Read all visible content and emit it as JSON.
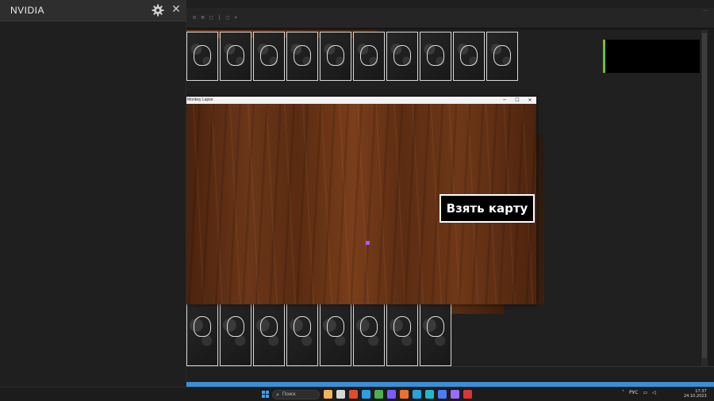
{
  "nvidia_overlay": {
    "title": "NVIDIA",
    "settings_icon": "gear-icon",
    "close_icon": "close-icon",
    "close_glyph": "✕"
  },
  "game_window": {
    "title": "Monkey Lapse",
    "minimize_glyph": "─",
    "maximize_glyph": "☐",
    "close_glyph": "✕",
    "take_card_label": "Взять карту"
  },
  "editor": {
    "toolbar_glyphs": "⊡ ⊞ ▢ | ▢ ▾",
    "top_right_glyph": "···"
  },
  "taskbar": {
    "search_placeholder": "Поиск",
    "search_icon_glyph": "⌕",
    "language": "РУС",
    "time": "17:37",
    "date": "24.10.2023",
    "app_colors": [
      "#f2b35a",
      "#d6d6d6",
      "#e24b2b",
      "#2aa0e6",
      "#4caf50",
      "#7a5cff",
      "#f0702b",
      "#25a3e0",
      "#22b8c7",
      "#4d7bff",
      "#9a6cff",
      "#d93636"
    ]
  },
  "accent_colors": {
    "nvidia_green": "#6ec12b",
    "status_blue": "#3b8fd9",
    "cursor_purple": "#b455ff"
  }
}
